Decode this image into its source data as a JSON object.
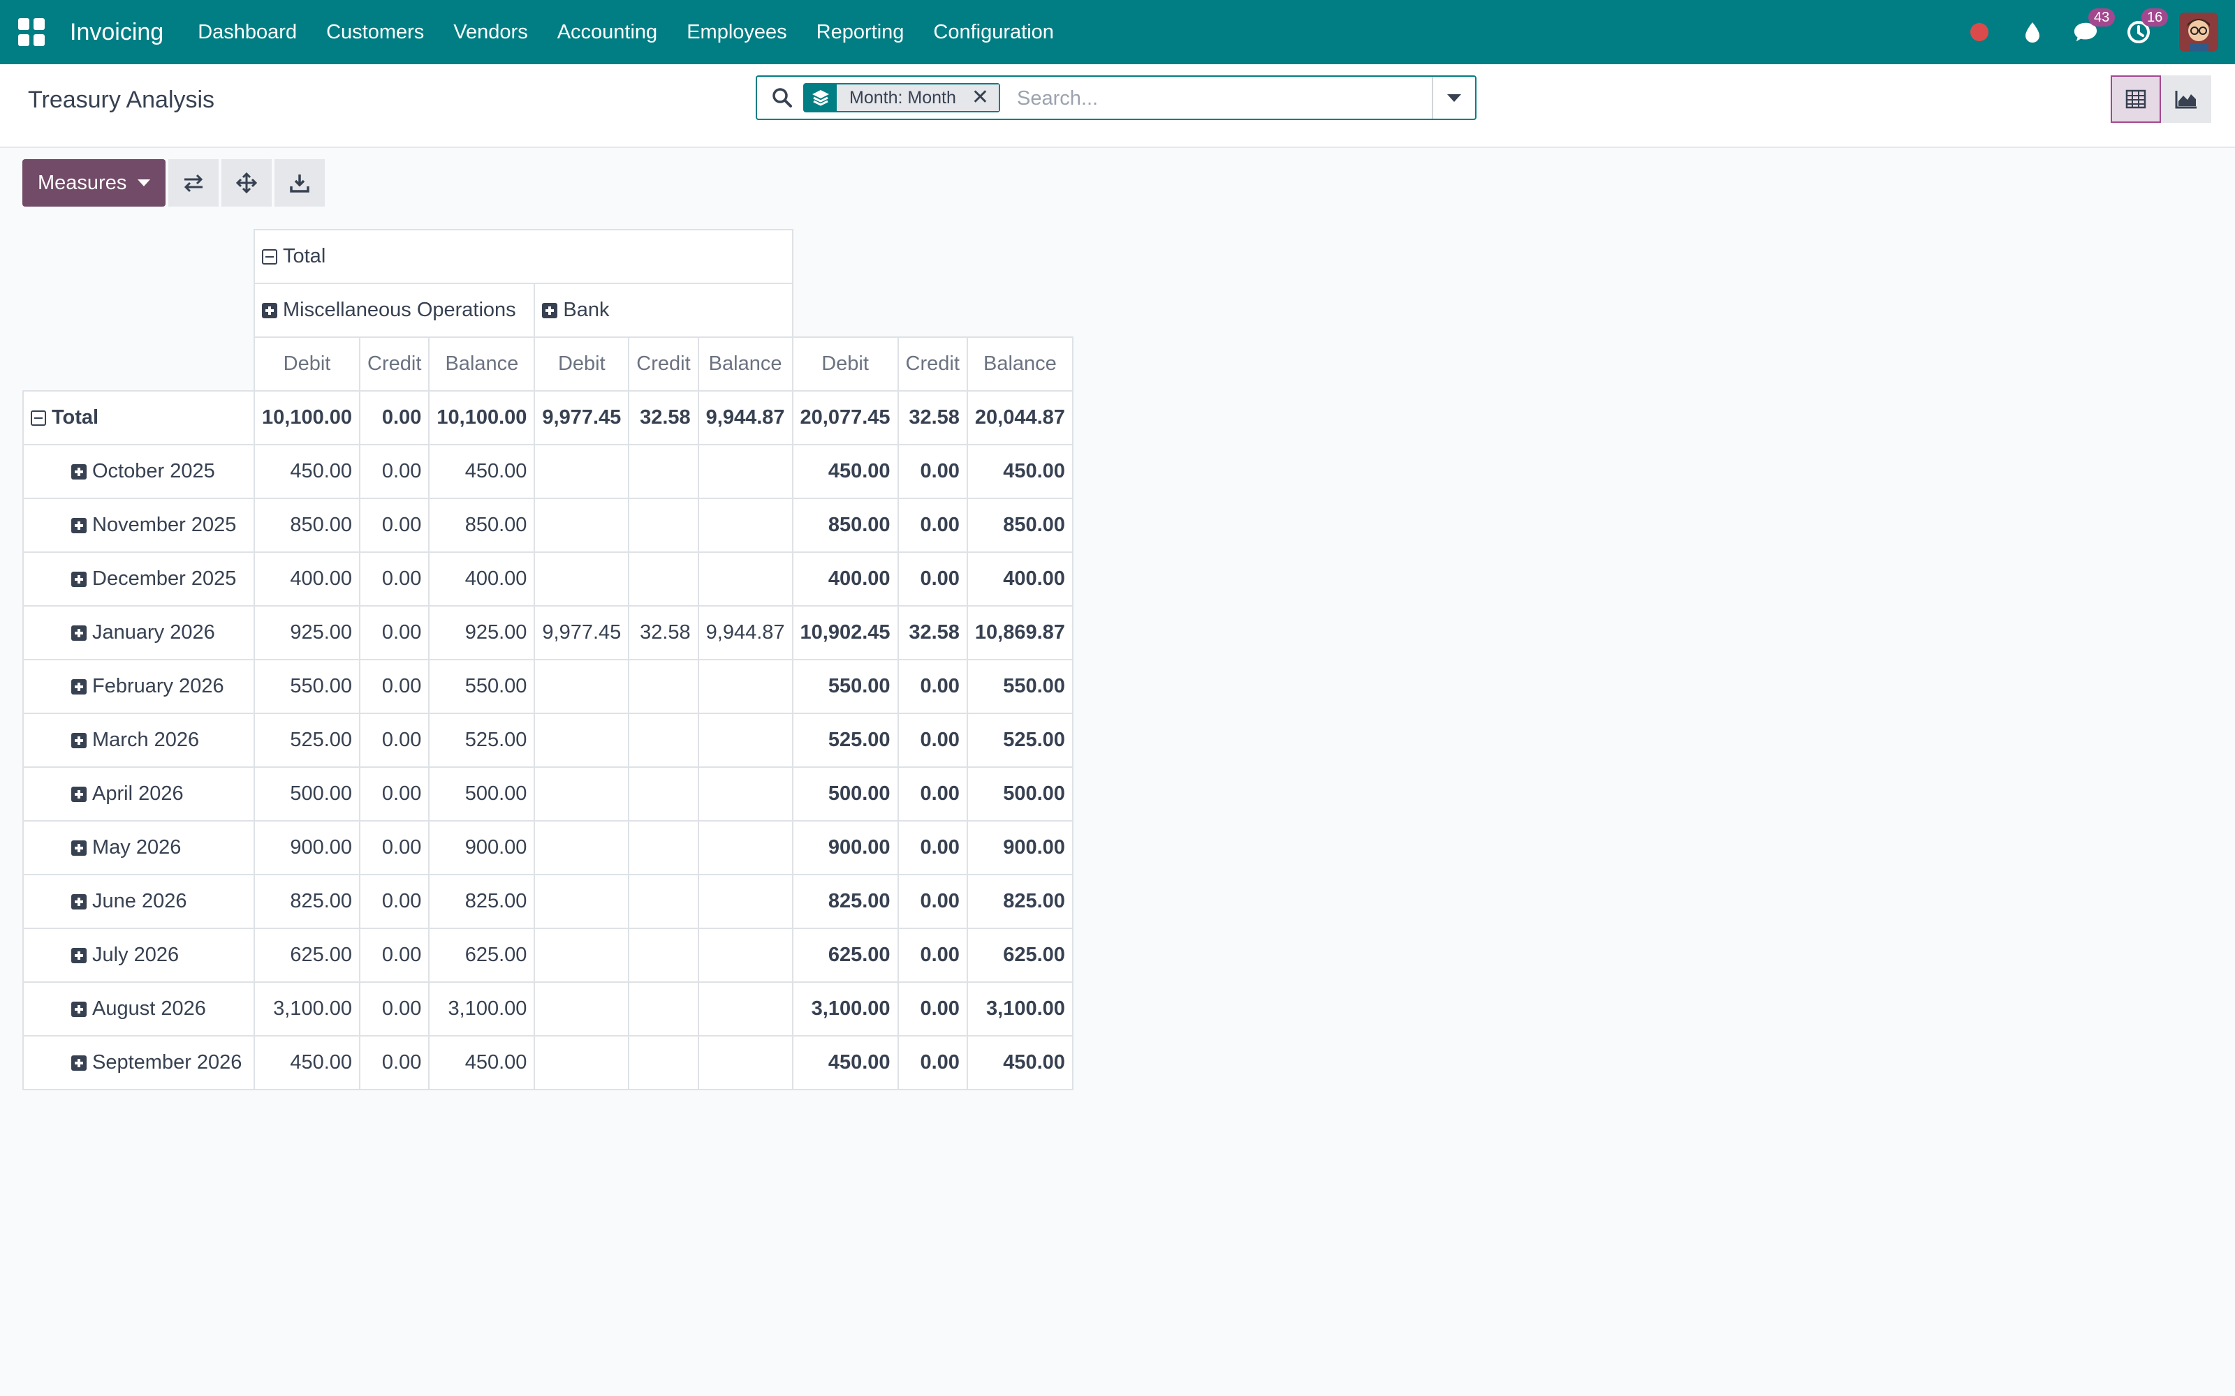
{
  "navbar": {
    "app_name": "Invoicing",
    "menu": [
      "Dashboard",
      "Customers",
      "Vendors",
      "Accounting",
      "Employees",
      "Reporting",
      "Configuration"
    ],
    "messages_count": "43",
    "activities_count": "16",
    "colors": {
      "navbar_bg": "#017e84",
      "badge": "#a3488f",
      "recording_dot": "#dc4b4b"
    }
  },
  "control_panel": {
    "title": "Treasury Analysis",
    "facet_label": "Month: Month",
    "search_placeholder": "Search...",
    "views": [
      "pivot-view",
      "graph-view"
    ],
    "active_view": "pivot-view"
  },
  "toolbar": {
    "measures_label": "Measures",
    "buttons": [
      "flip-axis-icon",
      "expand-all-icon",
      "download-icon"
    ],
    "colors": {
      "measures_bg": "#714b67"
    }
  },
  "pivot": {
    "col_total_label": "Total",
    "col_groups": [
      "Miscellaneous Operations",
      "Bank"
    ],
    "measures": [
      "Debit",
      "Credit",
      "Balance",
      "Debit",
      "Credit",
      "Balance",
      "Debit",
      "Credit",
      "Balance"
    ],
    "row_total_label": "Total",
    "total_row": [
      "10,100.00",
      "0.00",
      "10,100.00",
      "9,977.45",
      "32.58",
      "9,944.87",
      "20,077.45",
      "32.58",
      "20,044.87"
    ],
    "rows": [
      {
        "label": "October 2025",
        "cells": [
          "450.00",
          "0.00",
          "450.00",
          "",
          "",
          "",
          "450.00",
          "0.00",
          "450.00"
        ]
      },
      {
        "label": "November 2025",
        "cells": [
          "850.00",
          "0.00",
          "850.00",
          "",
          "",
          "",
          "850.00",
          "0.00",
          "850.00"
        ]
      },
      {
        "label": "December 2025",
        "cells": [
          "400.00",
          "0.00",
          "400.00",
          "",
          "",
          "",
          "400.00",
          "0.00",
          "400.00"
        ]
      },
      {
        "label": "January 2026",
        "cells": [
          "925.00",
          "0.00",
          "925.00",
          "9,977.45",
          "32.58",
          "9,944.87",
          "10,902.45",
          "32.58",
          "10,869.87"
        ]
      },
      {
        "label": "February 2026",
        "cells": [
          "550.00",
          "0.00",
          "550.00",
          "",
          "",
          "",
          "550.00",
          "0.00",
          "550.00"
        ]
      },
      {
        "label": "March 2026",
        "cells": [
          "525.00",
          "0.00",
          "525.00",
          "",
          "",
          "",
          "525.00",
          "0.00",
          "525.00"
        ]
      },
      {
        "label": "April 2026",
        "cells": [
          "500.00",
          "0.00",
          "500.00",
          "",
          "",
          "",
          "500.00",
          "0.00",
          "500.00"
        ]
      },
      {
        "label": "May 2026",
        "cells": [
          "900.00",
          "0.00",
          "900.00",
          "",
          "",
          "",
          "900.00",
          "0.00",
          "900.00"
        ]
      },
      {
        "label": "June 2026",
        "cells": [
          "825.00",
          "0.00",
          "825.00",
          "",
          "",
          "",
          "825.00",
          "0.00",
          "825.00"
        ]
      },
      {
        "label": "July 2026",
        "cells": [
          "625.00",
          "0.00",
          "625.00",
          "",
          "",
          "",
          "625.00",
          "0.00",
          "625.00"
        ]
      },
      {
        "label": "August 2026",
        "cells": [
          "3,100.00",
          "0.00",
          "3,100.00",
          "",
          "",
          "",
          "3,100.00",
          "0.00",
          "3,100.00"
        ]
      },
      {
        "label": "September 2026",
        "cells": [
          "450.00",
          "0.00",
          "450.00",
          "",
          "",
          "",
          "450.00",
          "0.00",
          "450.00"
        ]
      }
    ]
  }
}
